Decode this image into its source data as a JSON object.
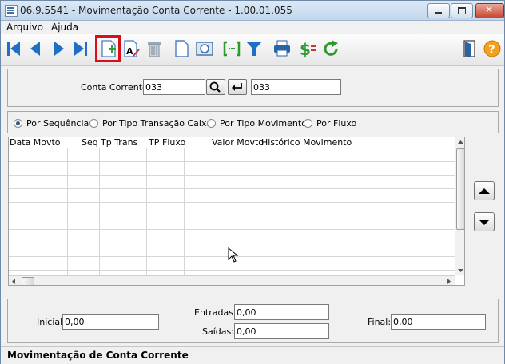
{
  "window": {
    "title": "06.9.5541 - Movimentação Conta Corrente - 1.00.01.055"
  },
  "menu": {
    "items": [
      "Arquivo",
      "Ajuda"
    ]
  },
  "toolbar": {
    "buttons": [
      "first-record-icon",
      "previous-record-icon",
      "next-record-icon",
      "last-record-icon",
      "new-record-icon",
      "edit-record-icon",
      "delete-icon",
      "document-icon",
      "preview-icon",
      "range-icon",
      "filter-icon",
      "print-icon",
      "currency-icon",
      "refresh-icon",
      "exit-icon",
      "help-icon"
    ],
    "highlighted": "new-record-icon"
  },
  "account": {
    "label": "Conta Corrente:",
    "code": "033",
    "name": "033"
  },
  "sort_options": {
    "selected": 0,
    "items": [
      "Por Sequência",
      "Por Tipo Transação Caixa",
      "Por Tipo Movimento",
      "Por Fluxo"
    ]
  },
  "grid": {
    "columns": [
      "Data Movto",
      "Seq",
      "Tp Trans",
      "TP",
      "Fluxo",
      "Valor Movto",
      "Histórico Movimento"
    ],
    "rows": []
  },
  "totals": {
    "initial_label": "Inicial:",
    "initial_value": "0,00",
    "entries_label": "Entradas:",
    "entries_value": "0,00",
    "exits_label": "Saídas:",
    "exits_value": "0,00",
    "final_label": "Final:",
    "final_value": "0,00"
  },
  "status": {
    "text": "Movimentação de Conta Corrente"
  },
  "colors": {
    "highlight": "#d9101a",
    "nav_blue": "#1f6fc7"
  }
}
